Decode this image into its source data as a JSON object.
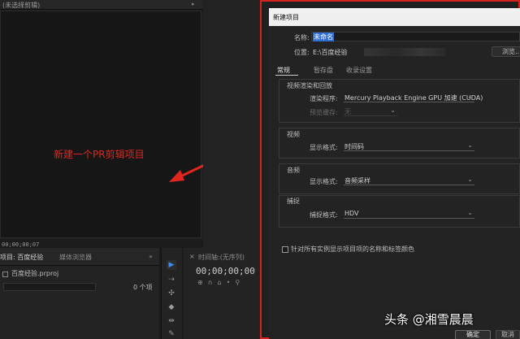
{
  "source": {
    "title": "(未选择剪辑)",
    "timecode": "00;00;00;07"
  },
  "annotation": {
    "text": "新建一个PR剪辑项目",
    "color": "#e0271f"
  },
  "project_panel": {
    "tab_project": "项目: 百度经验",
    "tab_media": "媒体浏览器",
    "more": "»",
    "file_name": "百度经验.prproj",
    "item_count": "0 个项"
  },
  "tools": {
    "select": "▶",
    "track": "⇢",
    "ripple": "✣",
    "razor": "◆",
    "slip": "⇹",
    "pen": "✎"
  },
  "timeline": {
    "close": "×",
    "title": "时间轴:(无序列)",
    "timecode": "00;00;00;00",
    "icons": "⊕∩⌂•⚲"
  },
  "dialog": {
    "title": "新建项目",
    "name_label": "名称:",
    "name_value": "未命名",
    "location_label": "位置:",
    "location_value": "E:\\百度经验",
    "browse_label": "浏览...",
    "tabs": {
      "general": "常规",
      "scratch": "暂存盘",
      "ingest": "收录设置"
    },
    "renderer": {
      "group_title": "视频渲染和回放",
      "renderer_label": "渲染程序:",
      "renderer_value": "Mercury Playback Engine GPU 加速 (CUDA)",
      "preview_label": "预览缓存:",
      "preview_value": "无"
    },
    "video": {
      "group_title": "视频",
      "display_label": "显示格式:",
      "display_value": "时间码"
    },
    "audio": {
      "group_title": "音频",
      "display_label": "显示格式:",
      "display_value": "音频采样"
    },
    "capture": {
      "group_title": "捕捉",
      "format_label": "捕捉格式:",
      "format_value": "HDV"
    },
    "checkbox_label": "针对所有实例显示项目项的名称和标签颜色",
    "ok_label": "确定",
    "cancel_label": "取消"
  },
  "watermark": "头条 @湘雪晨晨",
  "colors": {
    "highlight_frame": "#d5221d",
    "selection": "#2f6fd6",
    "accent_tool": "#3a8ef0"
  }
}
